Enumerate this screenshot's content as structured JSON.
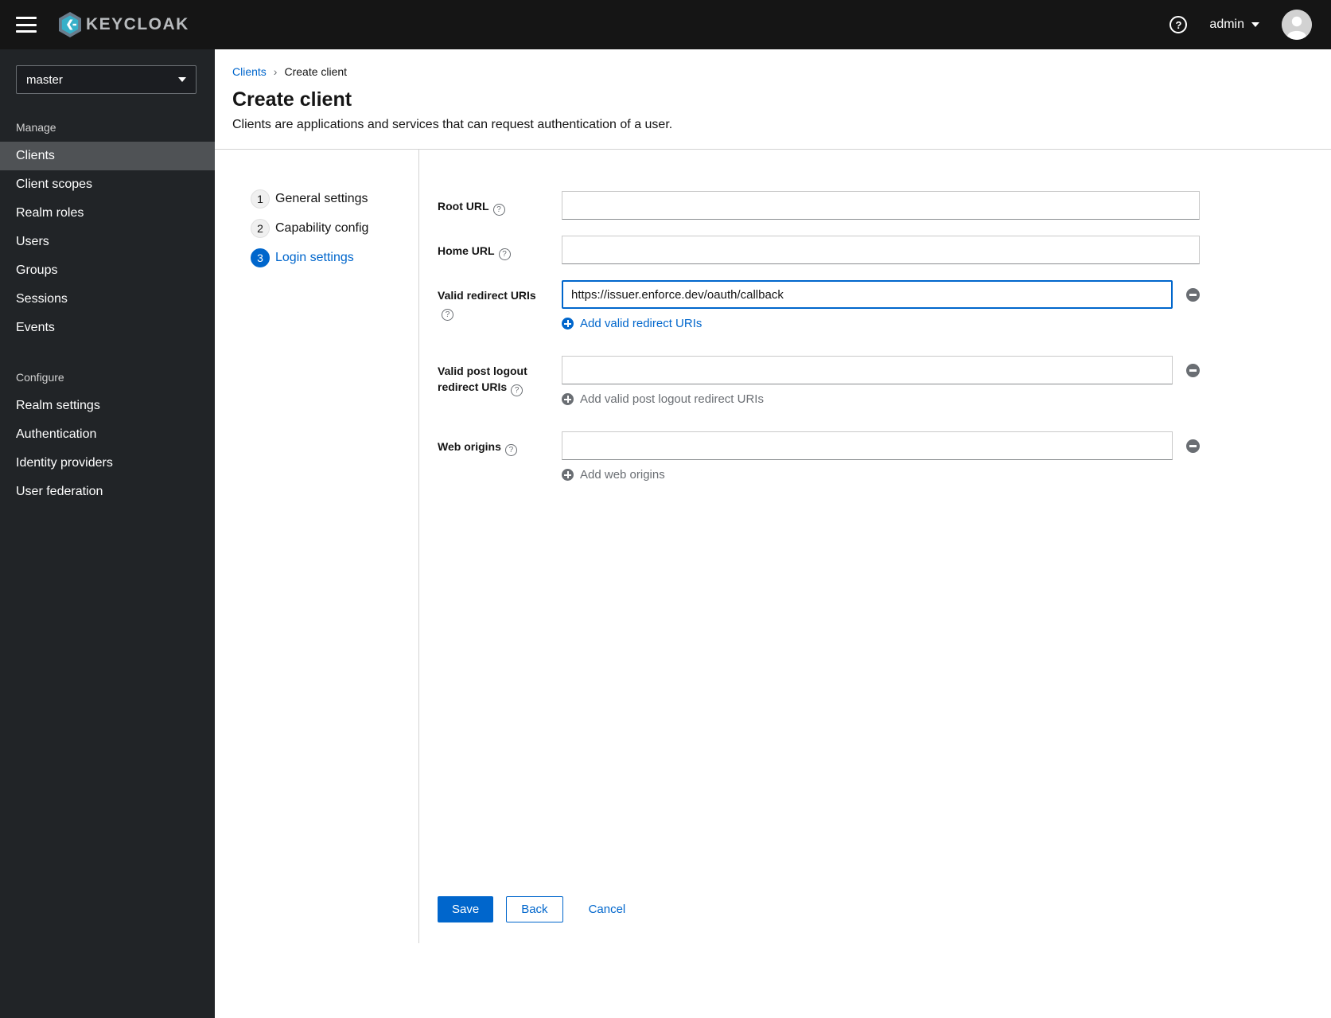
{
  "topbar": {
    "brand": "KEYCLOAK",
    "help_glyph": "?",
    "user_label": "admin"
  },
  "sidebar": {
    "realm_selector": "master",
    "sections": [
      {
        "title": "Manage",
        "items": [
          {
            "label": "Clients"
          },
          {
            "label": "Client scopes"
          },
          {
            "label": "Realm roles"
          },
          {
            "label": "Users"
          },
          {
            "label": "Groups"
          },
          {
            "label": "Sessions"
          },
          {
            "label": "Events"
          }
        ]
      },
      {
        "title": "Configure",
        "items": [
          {
            "label": "Realm settings"
          },
          {
            "label": "Authentication"
          },
          {
            "label": "Identity providers"
          },
          {
            "label": "User federation"
          }
        ]
      }
    ]
  },
  "breadcrumb": {
    "link": "Clients",
    "separator": "›",
    "current": "Create client"
  },
  "header": {
    "title": "Create client",
    "subtitle": "Clients are applications and services that can request authentication of a user."
  },
  "wizard": {
    "steps": [
      {
        "num": "1",
        "label": "General settings"
      },
      {
        "num": "2",
        "label": "Capability config"
      },
      {
        "num": "3",
        "label": "Login settings"
      }
    ],
    "active_step": "3"
  },
  "form": {
    "help_glyph": "?",
    "root_url": {
      "label": "Root URL",
      "value": ""
    },
    "home_url": {
      "label": "Home URL",
      "value": ""
    },
    "valid_redirect_uris": {
      "label": "Valid redirect URIs",
      "value": "https://issuer.enforce.dev/oauth/callback",
      "add_label": "Add valid redirect URIs"
    },
    "post_logout_redirect_uris": {
      "label": "Valid post logout redirect URIs",
      "value": "",
      "add_label": "Add valid post logout redirect URIs"
    },
    "web_origins": {
      "label": "Web origins",
      "value": "",
      "add_label": "Add web origins"
    }
  },
  "actions": {
    "save": "Save",
    "back": "Back",
    "cancel": "Cancel"
  },
  "colors": {
    "primary_blue": "#0066cc",
    "topbar_bg": "#151515",
    "sidebar_bg": "#212427",
    "active_nav_bg": "#4f5255",
    "muted_gray": "#6a6e73"
  }
}
